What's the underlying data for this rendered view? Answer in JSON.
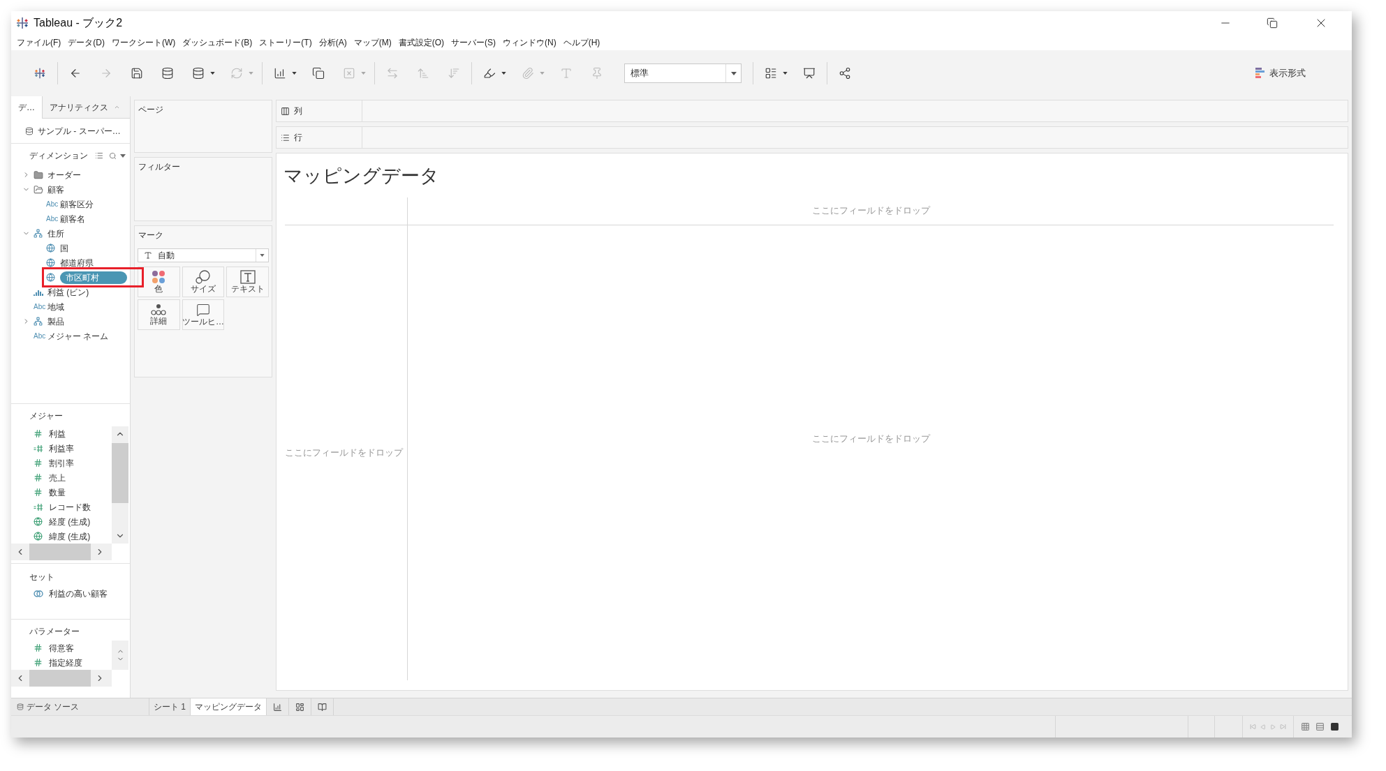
{
  "window": {
    "title": "Tableau - ブック2"
  },
  "menu": [
    "ファイル(F)",
    "データ(D)",
    "ワークシート(W)",
    "ダッシュボード(B)",
    "ストーリー(T)",
    "分析(A)",
    "マップ(M)",
    "書式設定(O)",
    "サーバー(S)",
    "ウィンドウ(N)",
    "ヘルプ(H)"
  ],
  "toolbar": {
    "groups": [
      [
        {
          "kind": "logo",
          "disabled": false,
          "dropdown": false
        }
      ],
      [
        {
          "kind": "back",
          "disabled": false,
          "dropdown": false
        },
        {
          "kind": "forward",
          "disabled": true,
          "dropdown": false
        },
        {
          "kind": "save",
          "disabled": false,
          "dropdown": false
        },
        {
          "kind": "datasource",
          "disabled": false,
          "dropdown": false
        },
        {
          "kind": "pause",
          "disabled": false,
          "dropdown": true
        },
        {
          "kind": "refresh",
          "disabled": true,
          "dropdown": true
        }
      ],
      [
        {
          "kind": "newsheet",
          "disabled": false,
          "dropdown": true
        },
        {
          "kind": "duplicate",
          "disabled": false,
          "dropdown": false
        },
        {
          "kind": "clear",
          "disabled": true,
          "dropdown": true
        }
      ],
      [
        {
          "kind": "swap",
          "disabled": true,
          "dropdown": false
        },
        {
          "kind": "sortasc",
          "disabled": true,
          "dropdown": false
        },
        {
          "kind": "sortdesc",
          "disabled": true,
          "dropdown": false
        }
      ],
      [
        {
          "kind": "highlight",
          "disabled": false,
          "dropdown": true
        },
        {
          "kind": "group",
          "disabled": true,
          "dropdown": true
        },
        {
          "kind": "labels",
          "disabled": true,
          "dropdown": false
        },
        {
          "kind": "pin",
          "disabled": true,
          "dropdown": false
        },
        {
          "kind": "select",
          "value": "標準"
        }
      ],
      [
        {
          "kind": "cards",
          "disabled": false,
          "dropdown": true
        },
        {
          "kind": "presentation",
          "disabled": false,
          "dropdown": false
        }
      ],
      [
        {
          "kind": "share",
          "disabled": false,
          "dropdown": false
        }
      ]
    ],
    "show_me": "表示形式"
  },
  "pane_tabs": [
    {
      "label": "デ…",
      "selected": true
    },
    {
      "label": "アナリティクス",
      "selected": false
    }
  ],
  "data_source": "サンプル - スーパー…",
  "dimensions": {
    "title": "ディメンション",
    "items": [
      {
        "label": "オーダー",
        "kind": "folder",
        "expanded": false,
        "selected": false,
        "annotated": false
      },
      {
        "label": "顧客",
        "kind": "folder",
        "expanded": true,
        "selected": false,
        "annotated": false,
        "children": [
          {
            "label": "顧客区分",
            "kind": "string",
            "type_label": "Abc",
            "selected": false,
            "annotated": false
          },
          {
            "label": "顧客名",
            "kind": "string",
            "type_label": "Abc",
            "selected": false,
            "annotated": false
          }
        ]
      },
      {
        "label": "住所",
        "kind": "hierarchy",
        "expanded": true,
        "selected": false,
        "annotated": false,
        "children": [
          {
            "label": "国",
            "kind": "geo",
            "selected": false,
            "annotated": false
          },
          {
            "label": "都道府県",
            "kind": "geo",
            "selected": false,
            "annotated": false
          },
          {
            "label": "市区町村",
            "kind": "geo",
            "selected": true,
            "annotated": true
          }
        ]
      },
      {
        "label": "利益 (ビン)",
        "kind": "bin",
        "selected": false,
        "annotated": false
      },
      {
        "label": "地域",
        "kind": "string",
        "type_label": "Abc",
        "selected": false,
        "annotated": false
      },
      {
        "label": "製品",
        "kind": "hierarchy",
        "expanded": false,
        "selected": false,
        "annotated": false
      },
      {
        "label": "メジャー ネーム",
        "kind": "string",
        "type_label": "Abc",
        "selected": false,
        "annotated": false
      }
    ]
  },
  "measures": {
    "title": "メジャー",
    "items": [
      {
        "label": "利益",
        "kind": "number"
      },
      {
        "label": "利益率",
        "kind": "calc"
      },
      {
        "label": "割引率",
        "kind": "number"
      },
      {
        "label": "売上",
        "kind": "number"
      },
      {
        "label": "数量",
        "kind": "number"
      },
      {
        "label": "レコード数",
        "kind": "calc"
      },
      {
        "label": "経度 (生成)",
        "kind": "geo"
      },
      {
        "label": "緯度 (生成)",
        "kind": "geo"
      }
    ]
  },
  "sets": {
    "title": "セット",
    "items": [
      {
        "label": "利益の高い顧客",
        "kind": "set"
      }
    ]
  },
  "parameters": {
    "title": "パラメーター",
    "items": [
      {
        "label": "得意客",
        "kind": "number"
      },
      {
        "label": "指定経度",
        "kind": "number"
      }
    ]
  },
  "pages": {
    "title": "ページ"
  },
  "filters": {
    "title": "フィルター"
  },
  "marks": {
    "title": "マーク",
    "type": "自動",
    "buttons": [
      {
        "label": "色",
        "kind": "color"
      },
      {
        "label": "サイズ",
        "kind": "size"
      },
      {
        "label": "テキスト",
        "kind": "text"
      },
      {
        "label": "詳細",
        "kind": "detail"
      },
      {
        "label": "ツールヒ…",
        "kind": "tooltip"
      }
    ]
  },
  "columns_shelf": {
    "label": "列"
  },
  "rows_shelf": {
    "label": "行"
  },
  "sheet": {
    "title": "マッピングデータ",
    "drop_top": "ここにフィールドをドロップ",
    "drop_left": "ここにフィールドをドロップ",
    "drop_center": "ここにフィールドをドロップ"
  },
  "data_source_tab": "データ ソース",
  "sheet_tabs": [
    {
      "label": "シート 1",
      "selected": false
    },
    {
      "label": "マッピングデータ",
      "selected": true
    }
  ],
  "view_modes": [
    {
      "selected": false
    },
    {
      "selected": false
    },
    {
      "selected": true
    }
  ]
}
